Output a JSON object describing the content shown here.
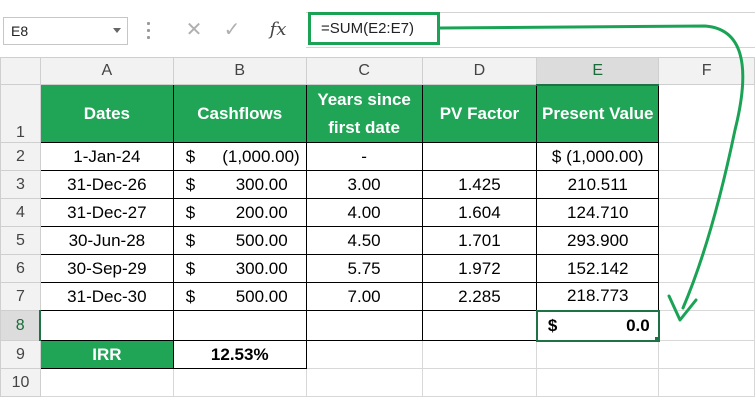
{
  "name_box": "E8",
  "formula": "=SUM(E2:E7)",
  "icons": {
    "cancel": "✕",
    "enter": "✓",
    "function": "fx"
  },
  "columns": [
    "A",
    "B",
    "C",
    "D",
    "E",
    "F"
  ],
  "rows": [
    "1",
    "2",
    "3",
    "4",
    "5",
    "6",
    "7",
    "8",
    "9",
    "10"
  ],
  "headers": {
    "dates": "Dates",
    "cashflows": "Cashflows",
    "years": "Years since first date",
    "pv_factor": "PV Factor",
    "present_value": "Present Value"
  },
  "table_rows": [
    {
      "date": "1-Jan-24",
      "cur": "$",
      "cashflow": "(1,000.00)",
      "years": "-",
      "pv": "",
      "present": "$ (1,000.00)"
    },
    {
      "date": "31-Dec-26",
      "cur": "$",
      "cashflow": "300.00",
      "years": "3.00",
      "pv": "1.425",
      "present": "210.511"
    },
    {
      "date": "31-Dec-27",
      "cur": "$",
      "cashflow": "200.00",
      "years": "4.00",
      "pv": "1.604",
      "present": "124.710"
    },
    {
      "date": "30-Jun-28",
      "cur": "$",
      "cashflow": "500.00",
      "years": "4.50",
      "pv": "1.701",
      "present": "293.900"
    },
    {
      "date": "30-Sep-29",
      "cur": "$",
      "cashflow": "300.00",
      "years": "5.75",
      "pv": "1.972",
      "present": "152.142"
    },
    {
      "date": "31-Dec-30",
      "cur": "$",
      "cashflow": "500.00",
      "years": "7.00",
      "pv": "2.285",
      "present": "218.773"
    }
  ],
  "total": {
    "cur": "$",
    "value": "0.0"
  },
  "irr": {
    "label": "IRR",
    "value": "12.53%"
  },
  "colors": {
    "accent_green": "#1fa555",
    "selection_green": "#1f7246",
    "arrow_green": "#1aa355"
  }
}
